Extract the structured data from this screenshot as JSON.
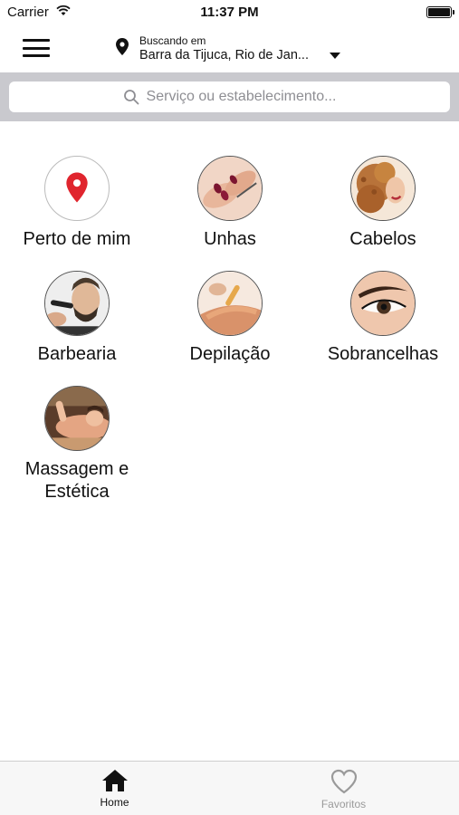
{
  "status_bar": {
    "carrier": "Carrier",
    "time": "11:37 PM",
    "battery_level": 1.0
  },
  "header": {
    "menu_icon": "hamburger-menu-icon",
    "location_icon": "map-pin-icon",
    "location_caption": "Buscando em",
    "location_value": "Barra da Tijuca, Rio de Jan...",
    "dropdown_icon": "caret-down-icon"
  },
  "search": {
    "icon": "search-icon",
    "placeholder": "Serviço ou estabelecimento..."
  },
  "categories": [
    {
      "label": "Perto de mim",
      "icon": "red-location-pin-icon"
    },
    {
      "label": "Unhas",
      "icon": "nails-photo"
    },
    {
      "label": "Cabelos",
      "icon": "curly-hair-photo"
    },
    {
      "label": "Barbearia",
      "icon": "barber-shave-photo"
    },
    {
      "label": "Depilação",
      "icon": "waxing-photo"
    },
    {
      "label": "Sobrancelhas",
      "icon": "eyebrow-photo"
    },
    {
      "label": "Massagem e Estética",
      "icon": "massage-photo"
    }
  ],
  "tabbar": {
    "tabs": [
      {
        "label": "Home",
        "icon": "home-icon",
        "active": true
      },
      {
        "label": "Favoritos",
        "icon": "heart-icon",
        "active": false
      }
    ]
  },
  "colors": {
    "accent_pin": "#e0252e",
    "search_band": "#c9c9ce",
    "inactive_tab": "#9a9a9a"
  }
}
